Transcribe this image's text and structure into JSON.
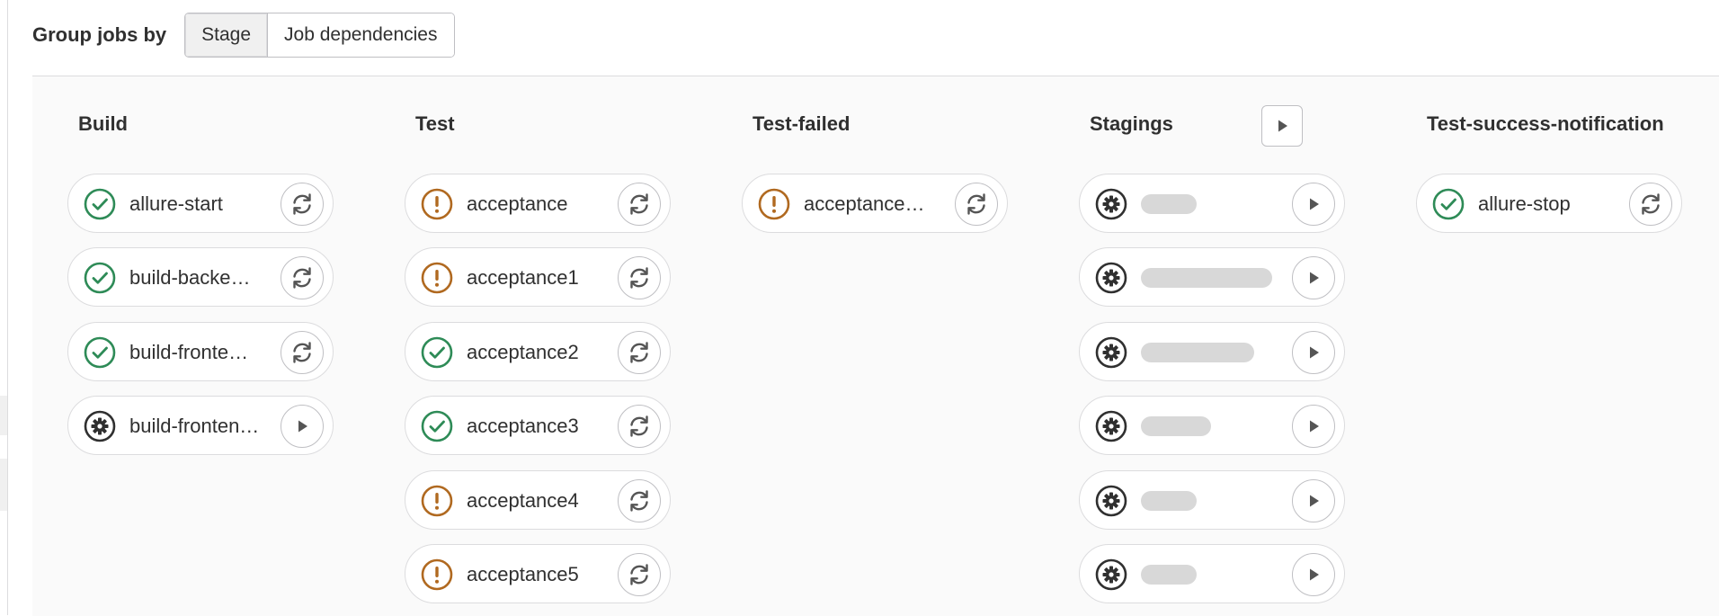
{
  "toolbar": {
    "label": "Group jobs by",
    "options": [
      {
        "label": "Stage",
        "selected": true
      },
      {
        "label": "Job dependencies",
        "selected": false
      }
    ]
  },
  "colors": {
    "success": "#2e8b57",
    "warning": "#b06920",
    "manual": "#303030"
  },
  "stages": [
    {
      "title": "Build",
      "has_stage_action": false,
      "jobs": [
        {
          "name": "allure-start",
          "status": "success",
          "status_icon": "check-circle-icon",
          "action": "retry",
          "action_icon": "retry-icon"
        },
        {
          "name": "build-backe…",
          "status": "success",
          "status_icon": "check-circle-icon",
          "action": "retry",
          "action_icon": "retry-icon"
        },
        {
          "name": "build-fronte…",
          "status": "success",
          "status_icon": "check-circle-icon",
          "action": "retry",
          "action_icon": "retry-icon"
        },
        {
          "name": "build-fronten…",
          "status": "manual",
          "status_icon": "gear-icon",
          "action": "play",
          "action_icon": "play-icon"
        }
      ]
    },
    {
      "title": "Test",
      "has_stage_action": false,
      "jobs": [
        {
          "name": "acceptance",
          "status": "warning",
          "status_icon": "warning-icon",
          "action": "retry",
          "action_icon": "retry-icon"
        },
        {
          "name": "acceptance1",
          "status": "warning",
          "status_icon": "warning-icon",
          "action": "retry",
          "action_icon": "retry-icon"
        },
        {
          "name": "acceptance2",
          "status": "success",
          "status_icon": "check-circle-icon",
          "action": "retry",
          "action_icon": "retry-icon"
        },
        {
          "name": "acceptance3",
          "status": "success",
          "status_icon": "check-circle-icon",
          "action": "retry",
          "action_icon": "retry-icon"
        },
        {
          "name": "acceptance4",
          "status": "warning",
          "status_icon": "warning-icon",
          "action": "retry",
          "action_icon": "retry-icon"
        },
        {
          "name": "acceptance5",
          "status": "warning",
          "status_icon": "warning-icon",
          "action": "retry",
          "action_icon": "retry-icon"
        }
      ]
    },
    {
      "title": "Test-failed",
      "has_stage_action": false,
      "jobs": [
        {
          "name": "acceptance…",
          "status": "warning",
          "status_icon": "warning-icon",
          "action": "retry",
          "action_icon": "retry-icon"
        }
      ]
    },
    {
      "title": "Stagings",
      "has_stage_action": true,
      "stage_action_icon": "play-icon",
      "jobs": [
        {
          "name": "",
          "redacted": true,
          "status": "manual",
          "status_icon": "gear-icon",
          "action": "play",
          "action_icon": "play-icon"
        },
        {
          "name": "",
          "redacted": true,
          "status": "manual",
          "status_icon": "gear-icon",
          "action": "play",
          "action_icon": "play-icon"
        },
        {
          "name": "",
          "redacted": true,
          "status": "manual",
          "status_icon": "gear-icon",
          "action": "play",
          "action_icon": "play-icon"
        },
        {
          "name": "",
          "redacted": true,
          "status": "manual",
          "status_icon": "gear-icon",
          "action": "play",
          "action_icon": "play-icon"
        },
        {
          "name": "",
          "redacted": true,
          "status": "manual",
          "status_icon": "gear-icon",
          "action": "play",
          "action_icon": "play-icon"
        },
        {
          "name": "",
          "redacted": true,
          "status": "manual",
          "status_icon": "gear-icon",
          "action": "play",
          "action_icon": "play-icon"
        }
      ]
    },
    {
      "title": "Test-success-notification",
      "has_stage_action": false,
      "jobs": [
        {
          "name": "allure-stop",
          "status": "success",
          "status_icon": "check-circle-icon",
          "action": "retry",
          "action_icon": "retry-icon"
        }
      ]
    }
  ]
}
